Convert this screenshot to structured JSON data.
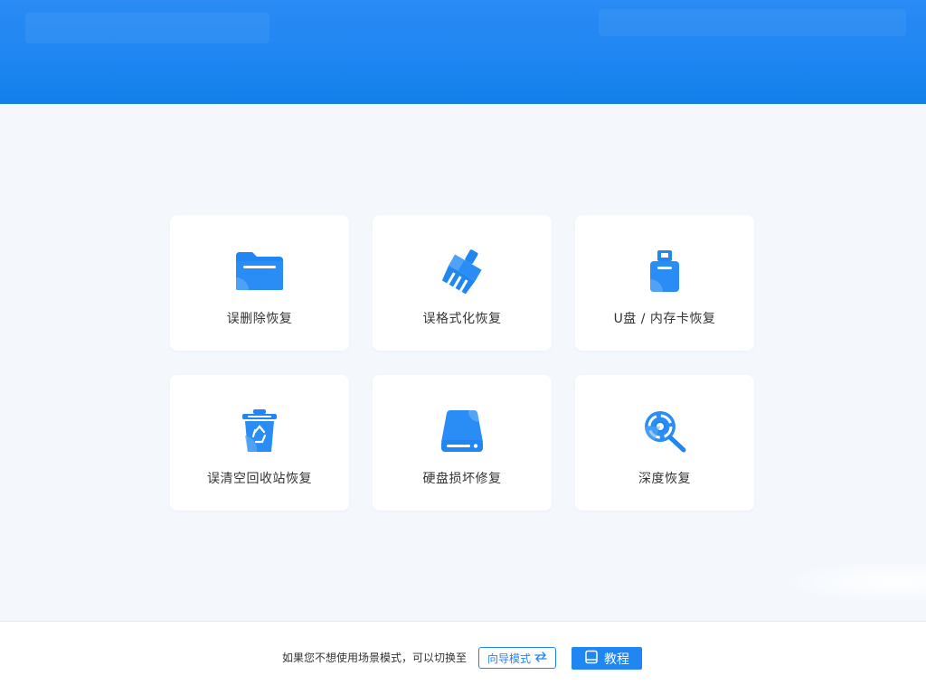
{
  "scenarios": [
    {
      "label": "误删除恢复",
      "icon": "folder-icon"
    },
    {
      "label": "误格式化恢复",
      "icon": "broom-icon"
    },
    {
      "label": "U盘 / 内存卡恢复",
      "icon": "usb-drive-icon"
    },
    {
      "label": "误清空回收站恢复",
      "icon": "recycle-bin-icon"
    },
    {
      "label": "硬盘损坏修复",
      "icon": "hard-disk-icon"
    },
    {
      "label": "深度恢复",
      "icon": "deep-search-icon"
    }
  ],
  "footer": {
    "hint": "如果您不想使用场景模式，可以切换至",
    "wizard_label": "向导模式",
    "tutorial_label": "教程"
  },
  "colors": {
    "accent": "#1f86f2",
    "accent_light": "#5aa8f7",
    "background": "#f4f8fd"
  }
}
